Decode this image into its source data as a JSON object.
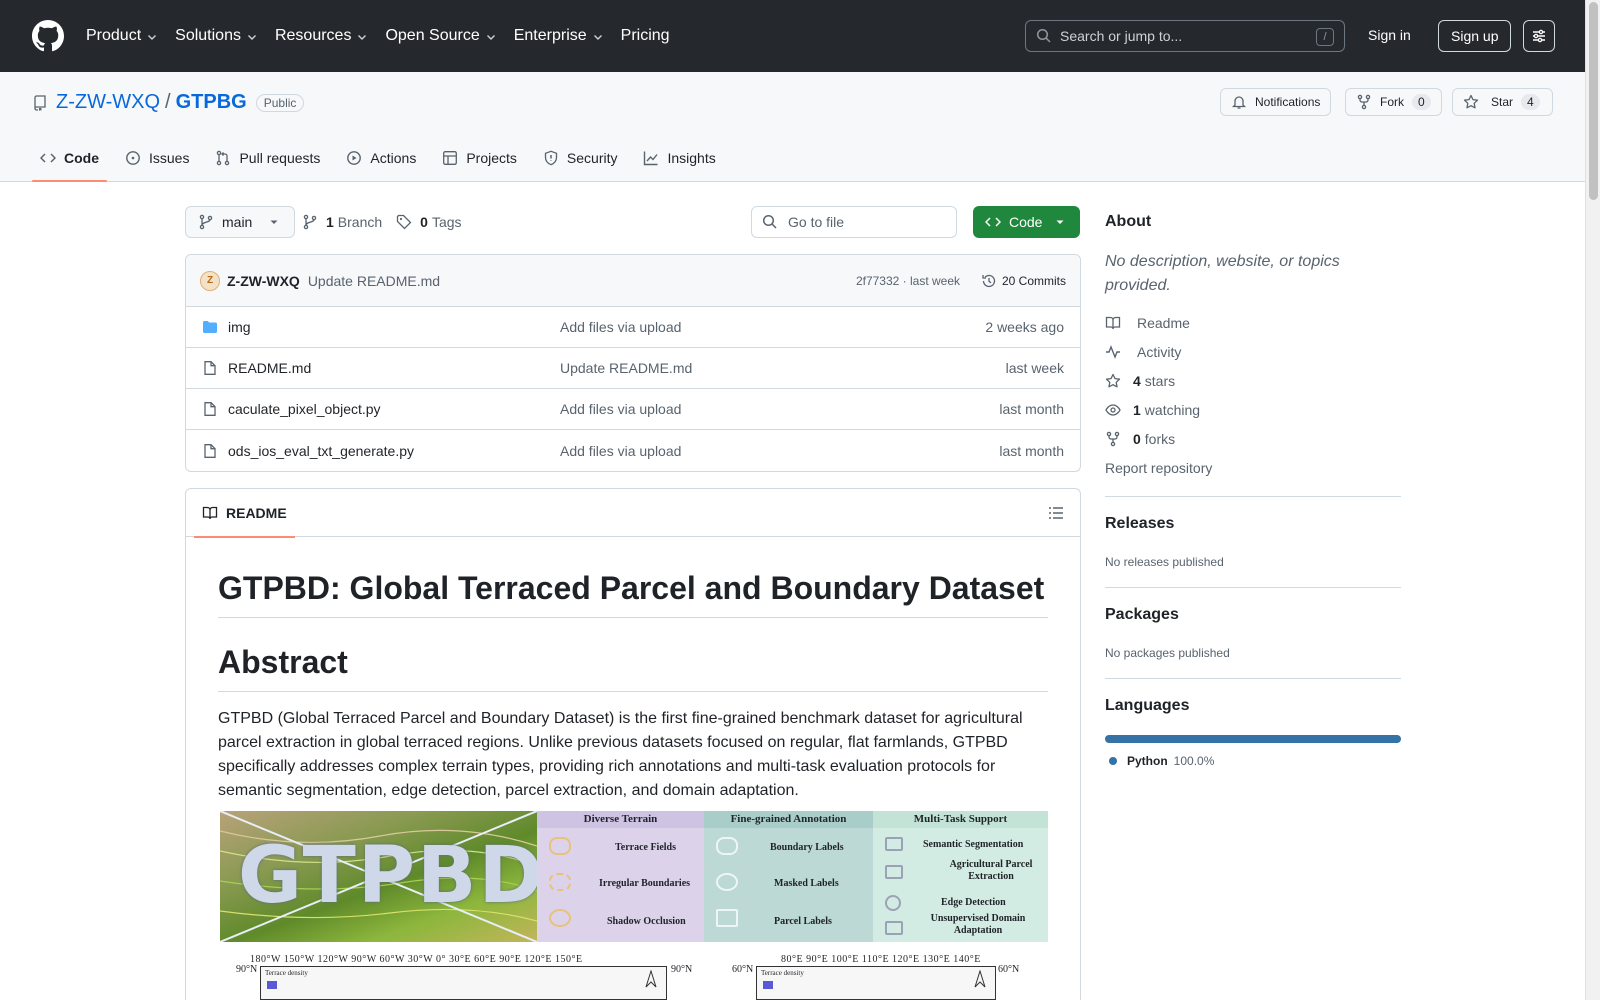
{
  "header": {
    "nav": [
      "Product",
      "Solutions",
      "Resources",
      "Open Source",
      "Enterprise",
      "Pricing"
    ],
    "search_placeholder": "Search or jump to...",
    "search_shortcut": "/",
    "signin": "Sign in",
    "signup": "Sign up"
  },
  "repo": {
    "owner": "Z-ZW-WXQ",
    "separator": "/",
    "name": "GTPBG",
    "visibility": "Public",
    "notifications": "Notifications",
    "fork_label": "Fork",
    "fork_count": "0",
    "star_label": "Star",
    "star_count": "4",
    "tabs": [
      "Code",
      "Issues",
      "Pull requests",
      "Actions",
      "Projects",
      "Security",
      "Insights"
    ]
  },
  "toolbar": {
    "branch": "main",
    "branch_count": "1",
    "branch_label": "Branch",
    "tag_count": "0",
    "tag_label": "Tags",
    "goto_placeholder": "Go to file",
    "code_button": "Code"
  },
  "commit": {
    "author": "Z-ZW-WXQ",
    "message": "Update README.md",
    "meta": "2f77332 · last week",
    "count": "20 Commits"
  },
  "files": [
    {
      "name": "img",
      "type": "folder",
      "message": "Add files via upload",
      "time": "2 weeks ago"
    },
    {
      "name": "README.md",
      "type": "file",
      "message": "Update README.md",
      "time": "last week"
    },
    {
      "name": "caculate_pixel_object.py",
      "type": "file",
      "message": "Add files via upload",
      "time": "last month"
    },
    {
      "name": "ods_ios_eval_txt_generate.py",
      "type": "file",
      "message": "Add files via upload",
      "time": "last month"
    }
  ],
  "readme": {
    "tab_label": "README",
    "title": "GTPBD: Global Terraced Parcel and Boundary Dataset",
    "abstract_heading": "Abstract",
    "abstract_text": "GTPBD (Global Terraced Parcel and Boundary Dataset) is the first fine-grained benchmark dataset for agricultural parcel extraction in global terraced regions. Unlike previous datasets focused on regular, flat farmlands, GTPBD specifically addresses complex terrain types, providing rich annotations and multi-task evaluation protocols for semantic segmentation, edge detection, parcel extraction, and domain adaptation.",
    "banner": {
      "logo_text": "GTPBD",
      "col1_title": "Diverse Terrain",
      "col1_items": [
        "Terrace Fields",
        "Irregular Boundaries",
        "Shadow Occlusion"
      ],
      "col2_title": "Fine-grained Annotation",
      "col2_items": [
        "Boundary Labels",
        "Masked Labels",
        "Parcel Labels"
      ],
      "col3_title": "Multi-Task Support",
      "col3_items": [
        "Semantic Segmentation",
        "Agricultural Parcel Extraction",
        "Edge Detection",
        "Unsupervised Domain Adaptation"
      ]
    },
    "map_left_ticks": "180°W 150°W 120°W 90°W 60°W 30°W 0° 30°E 60°E 90°E 120°E 150°E",
    "map_left_lat_l": "90°N",
    "map_left_lat_r": "90°N",
    "map_left_legend": "Terrace density",
    "map_right_ticks": "80°E 90°E 100°E 110°E 120°E 130°E 140°E",
    "map_right_lat_l": "60°N",
    "map_right_lat_r": "60°N",
    "map_right_legend": "Terrace density"
  },
  "sidebar": {
    "about_heading": "About",
    "description": "No description, website, or topics provided.",
    "links": [
      {
        "icon": "book-icon",
        "strong": "",
        "label": "Readme"
      },
      {
        "icon": "pulse-icon",
        "strong": "",
        "label": "Activity"
      },
      {
        "icon": "star-icon",
        "strong": "4",
        "label": "stars"
      },
      {
        "icon": "eye-icon",
        "strong": "1",
        "label": "watching"
      },
      {
        "icon": "fork-icon",
        "strong": "0",
        "label": "forks"
      }
    ],
    "report": "Report repository",
    "releases_heading": "Releases",
    "releases_text": "No releases published",
    "packages_heading": "Packages",
    "packages_text": "No packages published",
    "languages_heading": "Languages",
    "language": {
      "name": "Python",
      "percent": "100.0%",
      "color": "#3572a5"
    }
  }
}
